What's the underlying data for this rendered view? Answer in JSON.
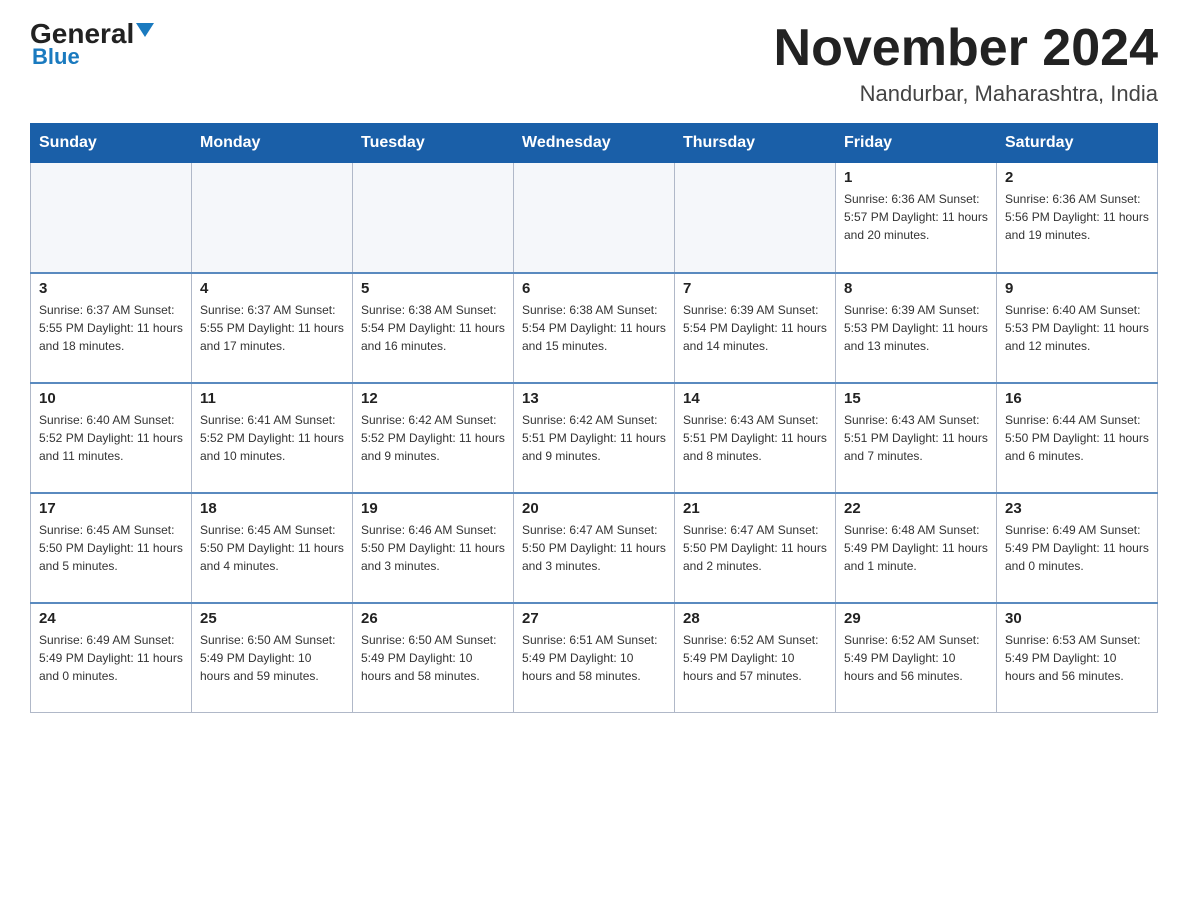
{
  "logo": {
    "general": "General",
    "blue": "Blue"
  },
  "title": {
    "month_year": "November 2024",
    "location": "Nandurbar, Maharashtra, India"
  },
  "days_of_week": [
    "Sunday",
    "Monday",
    "Tuesday",
    "Wednesday",
    "Thursday",
    "Friday",
    "Saturday"
  ],
  "weeks": [
    [
      {
        "day": "",
        "info": ""
      },
      {
        "day": "",
        "info": ""
      },
      {
        "day": "",
        "info": ""
      },
      {
        "day": "",
        "info": ""
      },
      {
        "day": "",
        "info": ""
      },
      {
        "day": "1",
        "info": "Sunrise: 6:36 AM\nSunset: 5:57 PM\nDaylight: 11 hours\nand 20 minutes."
      },
      {
        "day": "2",
        "info": "Sunrise: 6:36 AM\nSunset: 5:56 PM\nDaylight: 11 hours\nand 19 minutes."
      }
    ],
    [
      {
        "day": "3",
        "info": "Sunrise: 6:37 AM\nSunset: 5:55 PM\nDaylight: 11 hours\nand 18 minutes."
      },
      {
        "day": "4",
        "info": "Sunrise: 6:37 AM\nSunset: 5:55 PM\nDaylight: 11 hours\nand 17 minutes."
      },
      {
        "day": "5",
        "info": "Sunrise: 6:38 AM\nSunset: 5:54 PM\nDaylight: 11 hours\nand 16 minutes."
      },
      {
        "day": "6",
        "info": "Sunrise: 6:38 AM\nSunset: 5:54 PM\nDaylight: 11 hours\nand 15 minutes."
      },
      {
        "day": "7",
        "info": "Sunrise: 6:39 AM\nSunset: 5:54 PM\nDaylight: 11 hours\nand 14 minutes."
      },
      {
        "day": "8",
        "info": "Sunrise: 6:39 AM\nSunset: 5:53 PM\nDaylight: 11 hours\nand 13 minutes."
      },
      {
        "day": "9",
        "info": "Sunrise: 6:40 AM\nSunset: 5:53 PM\nDaylight: 11 hours\nand 12 minutes."
      }
    ],
    [
      {
        "day": "10",
        "info": "Sunrise: 6:40 AM\nSunset: 5:52 PM\nDaylight: 11 hours\nand 11 minutes."
      },
      {
        "day": "11",
        "info": "Sunrise: 6:41 AM\nSunset: 5:52 PM\nDaylight: 11 hours\nand 10 minutes."
      },
      {
        "day": "12",
        "info": "Sunrise: 6:42 AM\nSunset: 5:52 PM\nDaylight: 11 hours\nand 9 minutes."
      },
      {
        "day": "13",
        "info": "Sunrise: 6:42 AM\nSunset: 5:51 PM\nDaylight: 11 hours\nand 9 minutes."
      },
      {
        "day": "14",
        "info": "Sunrise: 6:43 AM\nSunset: 5:51 PM\nDaylight: 11 hours\nand 8 minutes."
      },
      {
        "day": "15",
        "info": "Sunrise: 6:43 AM\nSunset: 5:51 PM\nDaylight: 11 hours\nand 7 minutes."
      },
      {
        "day": "16",
        "info": "Sunrise: 6:44 AM\nSunset: 5:50 PM\nDaylight: 11 hours\nand 6 minutes."
      }
    ],
    [
      {
        "day": "17",
        "info": "Sunrise: 6:45 AM\nSunset: 5:50 PM\nDaylight: 11 hours\nand 5 minutes."
      },
      {
        "day": "18",
        "info": "Sunrise: 6:45 AM\nSunset: 5:50 PM\nDaylight: 11 hours\nand 4 minutes."
      },
      {
        "day": "19",
        "info": "Sunrise: 6:46 AM\nSunset: 5:50 PM\nDaylight: 11 hours\nand 3 minutes."
      },
      {
        "day": "20",
        "info": "Sunrise: 6:47 AM\nSunset: 5:50 PM\nDaylight: 11 hours\nand 3 minutes."
      },
      {
        "day": "21",
        "info": "Sunrise: 6:47 AM\nSunset: 5:50 PM\nDaylight: 11 hours\nand 2 minutes."
      },
      {
        "day": "22",
        "info": "Sunrise: 6:48 AM\nSunset: 5:49 PM\nDaylight: 11 hours\nand 1 minute."
      },
      {
        "day": "23",
        "info": "Sunrise: 6:49 AM\nSunset: 5:49 PM\nDaylight: 11 hours\nand 0 minutes."
      }
    ],
    [
      {
        "day": "24",
        "info": "Sunrise: 6:49 AM\nSunset: 5:49 PM\nDaylight: 11 hours\nand 0 minutes."
      },
      {
        "day": "25",
        "info": "Sunrise: 6:50 AM\nSunset: 5:49 PM\nDaylight: 10 hours\nand 59 minutes."
      },
      {
        "day": "26",
        "info": "Sunrise: 6:50 AM\nSunset: 5:49 PM\nDaylight: 10 hours\nand 58 minutes."
      },
      {
        "day": "27",
        "info": "Sunrise: 6:51 AM\nSunset: 5:49 PM\nDaylight: 10 hours\nand 58 minutes."
      },
      {
        "day": "28",
        "info": "Sunrise: 6:52 AM\nSunset: 5:49 PM\nDaylight: 10 hours\nand 57 minutes."
      },
      {
        "day": "29",
        "info": "Sunrise: 6:52 AM\nSunset: 5:49 PM\nDaylight: 10 hours\nand 56 minutes."
      },
      {
        "day": "30",
        "info": "Sunrise: 6:53 AM\nSunset: 5:49 PM\nDaylight: 10 hours\nand 56 minutes."
      }
    ]
  ]
}
